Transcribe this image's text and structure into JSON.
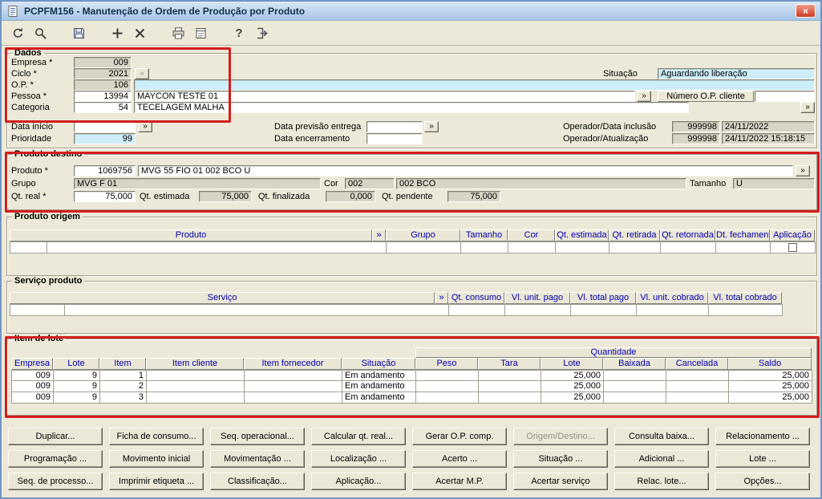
{
  "window": {
    "title": "PCPFM156 - Manutenção de Ordem de Produção por Produto"
  },
  "ui": {
    "lookup": "»",
    "close": "×",
    "help": "?"
  },
  "toolbar": {
    "icons": [
      "refresh-icon",
      "search-icon",
      "save-icon",
      "add-icon",
      "delete-icon",
      "print-icon",
      "schedule-icon",
      "help-icon",
      "exit-icon"
    ]
  },
  "dados": {
    "legend": "Dados",
    "empresa_label": "Empresa *",
    "empresa_value": "009",
    "ciclo_label": "Ciclo *",
    "ciclo_value": "2021",
    "op_label": "O.P. *",
    "op_value": "106",
    "op_desc": "",
    "pessoa_label": "Pessoa *",
    "pessoa_code": "13994",
    "pessoa_name": "MAYCON TESTE 01",
    "categoria_label": "Categoria",
    "categoria_code": "54",
    "categoria_name": "TECELAGEM MALHA",
    "situacao_label": "Situação",
    "situacao_value": "Aguardando liberação",
    "numero_op_cliente_label": "Número O.P. cliente",
    "numero_op_cliente_value": "",
    "data_inicio_label": "Data início",
    "data_inicio_value": "",
    "prioridade_label": "Prioridade",
    "prioridade_value": "99",
    "data_previsao_label": "Data previsão entrega",
    "data_previsao_value": "",
    "data_encerramento_label": "Data encerramento",
    "data_encerramento_value": "",
    "operador_inclusao_label": "Operador/Data inclusão",
    "operador_inclusao_code": "999998",
    "operador_inclusao_data": "24/11/2022",
    "operador_atualizacao_label": "Operador/Atualização",
    "operador_atualizacao_code": "999998",
    "operador_atualizacao_data": "24/11/2022 15:18:15"
  },
  "produto_destino": {
    "legend": "Produto destino",
    "produto_label": "Produto *",
    "produto_code": "1069756",
    "produto_desc": "MVG 55 FIO 01 002 BCO U",
    "grupo_label": "Grupo",
    "grupo_value": "MVG F 01",
    "cor_label": "Cor",
    "cor_code": "002",
    "cor_desc": "002 BCO",
    "tamanho_label": "Tamanho",
    "tamanho_value": "U",
    "qt_real_label": "Qt. real *",
    "qt_real_value": "75,000",
    "qt_estimada_label": "Qt. estimada",
    "qt_estimada_value": "75,000",
    "qt_finalizada_label": "Qt. finalizada",
    "qt_finalizada_value": "0,000",
    "qt_pendente_label": "Qt. pendente",
    "qt_pendente_value": "75,000"
  },
  "produto_origem": {
    "legend": "Produto origem",
    "headers": [
      "Produto",
      "»",
      "Grupo",
      "Tamanho",
      "Cor",
      "Qt. estimada",
      "Qt. retirada",
      "Qt. retornada",
      "Dt. fechamento",
      "Aplicação"
    ]
  },
  "servico_produto": {
    "legend": "Serviço produto",
    "headers": [
      "Serviço",
      "»",
      "Qt. consumo",
      "Vl. unit. pago",
      "Vl. total pago",
      "Vl. unit. cobrado",
      "Vl. total cobrado"
    ]
  },
  "item_de_lote": {
    "legend": "Item de lote",
    "quantidade_header": "Quantidade",
    "headers": [
      "Empresa",
      "Lote",
      "Item",
      "Item cliente",
      "Item fornecedor",
      "Situação",
      "Peso",
      "Tara",
      "Lote",
      "Baixada",
      "Cancelada",
      "Saldo"
    ],
    "rows": [
      [
        "009",
        "9",
        "1",
        "",
        "",
        "Em andamento",
        "",
        "",
        "25,000",
        "",
        "",
        "25,000"
      ],
      [
        "009",
        "9",
        "2",
        "",
        "",
        "Em andamento",
        "",
        "",
        "25,000",
        "",
        "",
        "25,000"
      ],
      [
        "009",
        "9",
        "3",
        "",
        "",
        "Em andamento",
        "",
        "",
        "25,000",
        "",
        "",
        "25,000"
      ]
    ]
  },
  "buttons": {
    "row1": [
      "Duplicar...",
      "Ficha de consumo...",
      "Seq. operacional...",
      "Calcular qt. real...",
      "Gerar O.P. comp.",
      "Origem/Destino...",
      "Consulta baixa...",
      "Relacionamento ..."
    ],
    "row2": [
      "Programação ...",
      "Movimento inicial",
      "Movimentação ...",
      "Localização ...",
      "Acerto ...",
      "Situação ...",
      "Adicional ...",
      "Lote ..."
    ],
    "row3": [
      "Seq. de processo...",
      "Imprimir etiqueta ...",
      "Classificação...",
      "Aplicação...",
      "Acertar M.P.",
      "Acertar serviço",
      "Relac. lote...",
      "Opções..."
    ]
  }
}
